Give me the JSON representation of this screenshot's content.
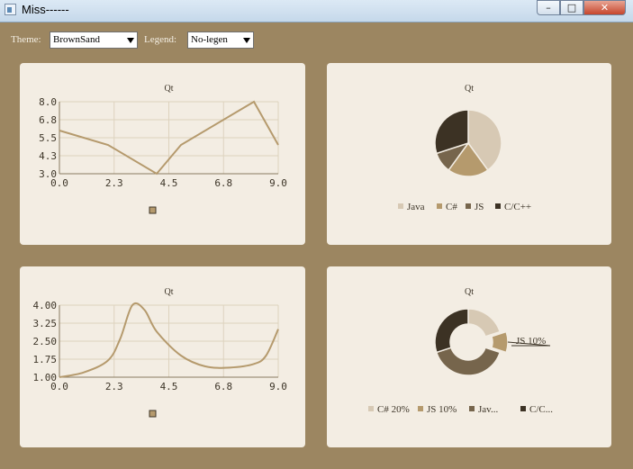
{
  "window": {
    "title": "Miss------",
    "min": "–",
    "max": "□",
    "close": "✕"
  },
  "toolbar": {
    "theme_label": "Theme:",
    "theme_value": "BrownSand",
    "legend_label": "Legend:",
    "legend_value": "No-legen"
  },
  "colors": {
    "bg": "#9c8661",
    "panel": "#f3ede3",
    "line": "#b59a6d",
    "grid": "#ddd2be",
    "java": "#d7c9b4",
    "csharp": "#b59a6d",
    "js": "#76654c",
    "cpp": "#3c3224"
  },
  "chart_data": [
    {
      "type": "line",
      "title": "Qt",
      "x": [
        0,
        2,
        4,
        5,
        8,
        9
      ],
      "y": [
        6,
        5,
        3,
        5,
        8,
        5
      ],
      "xlim": [
        0,
        9
      ],
      "ylim": [
        3,
        8
      ],
      "xticks": [
        "0.0",
        "2.3",
        "4.5",
        "6.8",
        "9.0"
      ],
      "yticks": [
        "3.0",
        "4.3",
        "5.5",
        "6.8",
        "8.0"
      ],
      "grid": true,
      "legend": "bottom"
    },
    {
      "type": "pie",
      "title": "Qt",
      "labels": [
        "Java",
        "C#",
        "JS",
        "C/C++"
      ],
      "values": [
        40,
        20,
        10,
        30
      ],
      "legend": "bottom"
    },
    {
      "type": "line",
      "title": "Qt",
      "x": [
        0,
        1,
        2,
        2.5,
        3,
        3.5,
        4,
        5,
        6,
        7,
        8,
        8.5,
        9
      ],
      "y": [
        1,
        1.2,
        1.7,
        2.6,
        4,
        3.8,
        2.9,
        1.9,
        1.45,
        1.4,
        1.55,
        1.9,
        3
      ],
      "xlim": [
        0,
        9
      ],
      "ylim": [
        1,
        4
      ],
      "xticks": [
        "0.0",
        "2.3",
        "4.5",
        "6.8",
        "9.0"
      ],
      "yticks": [
        "1.00",
        "1.75",
        "2.50",
        "3.25",
        "4.00"
      ],
      "grid": true,
      "legend": "bottom"
    },
    {
      "type": "pie",
      "title": "Qt",
      "labels": [
        "C# 20%",
        "JS 10%",
        "Jav...",
        "C/C..."
      ],
      "values": [
        20,
        10,
        40,
        30
      ],
      "callout": "JS 10%",
      "donut": true,
      "legend": "bottom"
    }
  ]
}
